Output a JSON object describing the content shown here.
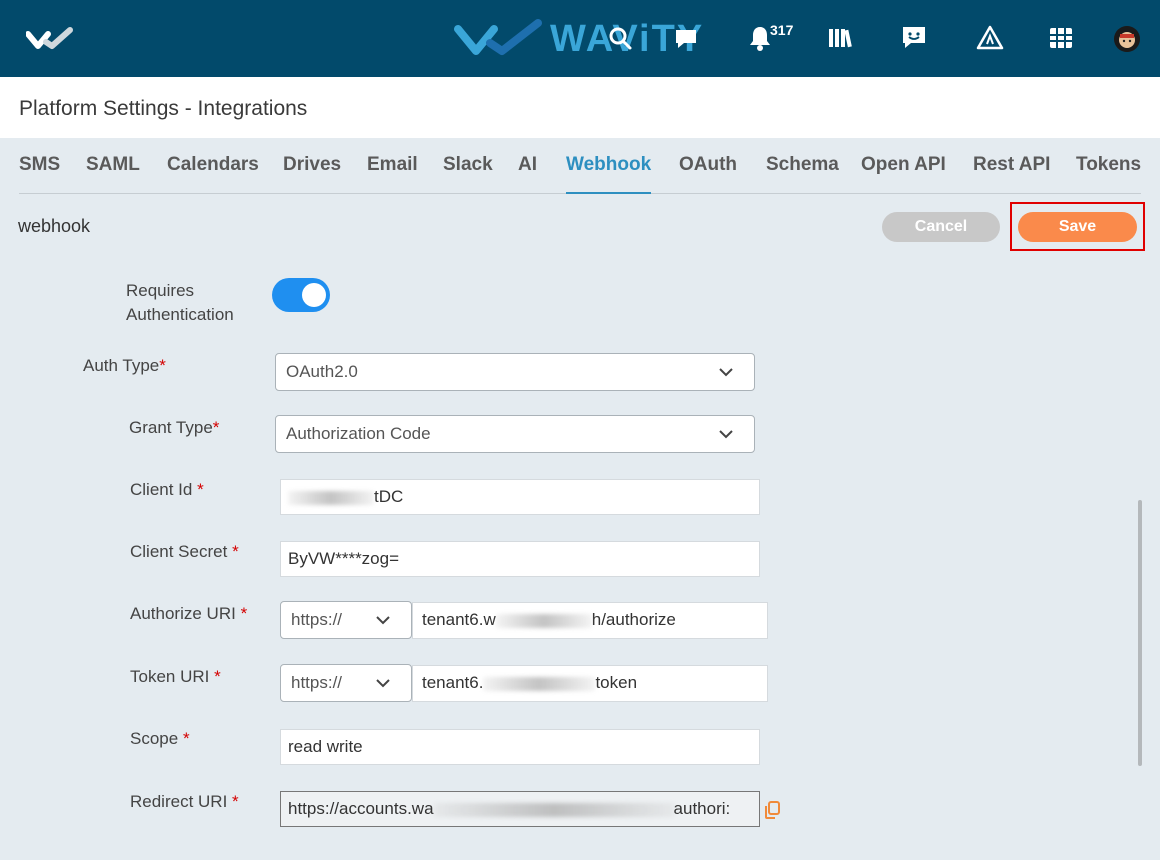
{
  "topbar": {
    "brand": "WAViTY",
    "notification_count": "317",
    "icons": [
      "menu-logo-icon",
      "search-icon",
      "chat-bubble-icon",
      "bell-icon",
      "library-books-icon",
      "feedback-icon",
      "warning-road-icon",
      "grid-table-icon",
      "avatar-icon"
    ]
  },
  "header": {
    "title": "Platform Settings - Integrations"
  },
  "tabs": [
    {
      "label": "SMS"
    },
    {
      "label": "SAML"
    },
    {
      "label": "Calendars"
    },
    {
      "label": "Drives"
    },
    {
      "label": "Email"
    },
    {
      "label": "Slack"
    },
    {
      "label": "AI"
    },
    {
      "label": "Webhook"
    },
    {
      "label": "OAuth"
    },
    {
      "label": "Schema"
    },
    {
      "label": "Open API"
    },
    {
      "label": "Rest API"
    },
    {
      "label": "Tokens"
    }
  ],
  "active_tab": "Webhook",
  "section": {
    "label": "webhook",
    "cancel_label": "Cancel",
    "save_label": "Save"
  },
  "form": {
    "requires_auth_label_1": "Requires",
    "requires_auth_label_2": "Authentication",
    "requires_auth_on": true,
    "auth_type_label": "Auth Type",
    "auth_type_value": "OAuth2.0",
    "grant_type_label": "Grant Type",
    "grant_type_value": "Authorization Code",
    "client_id_label": "Client Id",
    "client_id_suffix": "tDC",
    "client_secret_label": "Client Secret",
    "client_secret_value": "ByVW****zog=",
    "authorize_uri_label": "Authorize URI",
    "authorize_protocol": "https://",
    "authorize_prefix": "tenant6.w",
    "authorize_suffix": "h/authorize",
    "token_uri_label": "Token URI",
    "token_protocol": "https://",
    "token_prefix": "tenant6.",
    "token_suffix": "token",
    "scope_label": "Scope",
    "scope_value": "read write",
    "redirect_uri_label": "Redirect URI",
    "redirect_prefix": "https://accounts.wa",
    "redirect_suffix": "authori:",
    "required_mark": "*"
  },
  "colors": {
    "topbar": "#024a6b",
    "accent": "#2d8fc0",
    "save": "#fa8a4b",
    "cancel": "#c8c8c8",
    "toggle": "#1f8ff0",
    "highlight": "#e00000"
  }
}
